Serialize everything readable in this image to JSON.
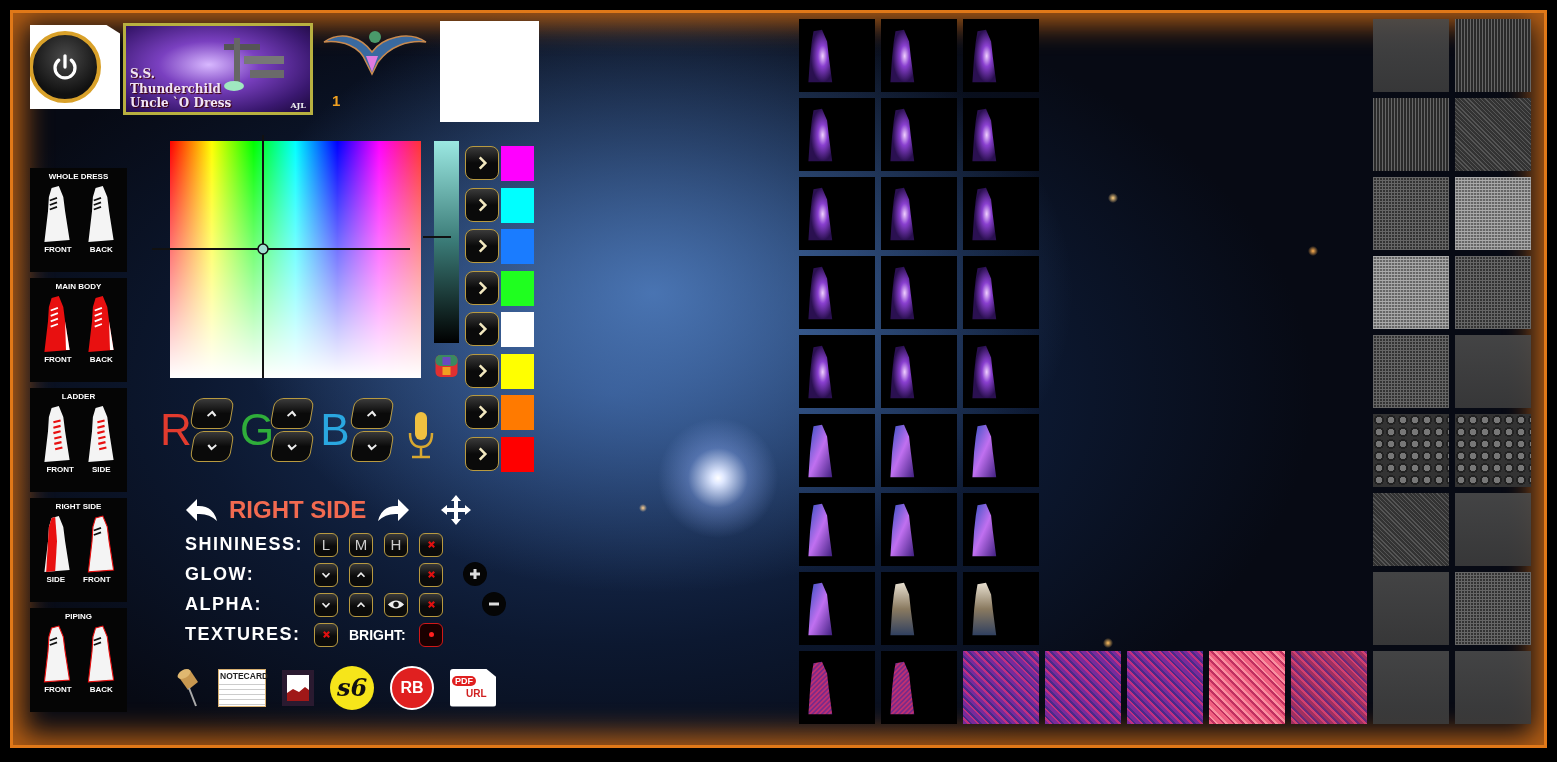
{
  "banner": {
    "lines": [
      "S.S.",
      "Thunderchild",
      "Uncle `O Dress"
    ],
    "signature": "AJL"
  },
  "counter": "1",
  "dress_parts": [
    {
      "title": "WHOLE DRESS",
      "views": [
        {
          "label": "FRONT",
          "kind": "white"
        },
        {
          "label": "BACK",
          "kind": "white"
        }
      ]
    },
    {
      "title": "MAIN BODY",
      "views": [
        {
          "label": "FRONT",
          "kind": "red"
        },
        {
          "label": "BACK",
          "kind": "red"
        }
      ]
    },
    {
      "title": "LADDER",
      "views": [
        {
          "label": "FRONT",
          "kind": "ladder"
        },
        {
          "label": "SIDE",
          "kind": "ladder"
        }
      ]
    },
    {
      "title": "RIGHT SIDE",
      "views": [
        {
          "label": "SIDE",
          "kind": "redside"
        },
        {
          "label": "FRONT",
          "kind": "piping"
        }
      ]
    },
    {
      "title": "PIPING",
      "views": [
        {
          "label": "FRONT",
          "kind": "piping"
        },
        {
          "label": "BACK",
          "kind": "piping"
        }
      ]
    }
  ],
  "brightness": {
    "level": 0.52
  },
  "color_presets": [
    {
      "color": "#ff00ff"
    },
    {
      "color": "#00ffff"
    },
    {
      "color": "#1a7cff"
    },
    {
      "color": "#1fff1f"
    },
    {
      "color": "#ffffff"
    },
    {
      "color": "#ffff00"
    },
    {
      "color": "#ff7a00"
    },
    {
      "color": "#ff0000"
    }
  ],
  "rgb": [
    {
      "letter": "R",
      "color": "#e23b2e"
    },
    {
      "letter": "G",
      "color": "#2fae3a"
    },
    {
      "letter": "B",
      "color": "#2aa7e0"
    }
  ],
  "section": {
    "title": "RIGHT SIDE",
    "rows": [
      {
        "label": "SHININESS:",
        "buttons": [
          {
            "kind": "text",
            "text": "L"
          },
          {
            "kind": "text",
            "text": "M"
          },
          {
            "kind": "text",
            "text": "H"
          },
          {
            "kind": "clear"
          }
        ]
      },
      {
        "label": "GLOW:",
        "buttons": [
          {
            "kind": "down"
          },
          {
            "kind": "up"
          },
          {
            "kind": "empty"
          },
          {
            "kind": "clear"
          }
        ]
      },
      {
        "label": "ALPHA:",
        "buttons": [
          {
            "kind": "down"
          },
          {
            "kind": "up"
          },
          {
            "kind": "eye"
          },
          {
            "kind": "clear"
          }
        ]
      },
      {
        "label": "TEXTURES:",
        "buttons": [
          {
            "kind": "clear"
          },
          {
            "kind": "label",
            "text": "BRIGHT:"
          },
          {
            "kind": "dot"
          }
        ]
      }
    ]
  },
  "tools": [
    {
      "kind": "pin"
    },
    {
      "kind": "notecard",
      "text": "NOTECARD"
    },
    {
      "kind": "image"
    },
    {
      "kind": "s6",
      "text": "s6"
    },
    {
      "kind": "rb",
      "text": "RB"
    },
    {
      "kind": "pdf",
      "text": "PDF",
      "text2": "URL"
    }
  ],
  "thumbnails": [
    {
      "kind": "nebula"
    },
    {
      "kind": "nebula"
    },
    {
      "kind": "nebula"
    },
    {
      "kind": "nebula"
    },
    {
      "kind": "nebula"
    },
    {
      "kind": "nebula"
    },
    {
      "kind": "nebula"
    },
    {
      "kind": "nebula"
    },
    {
      "kind": "nebula"
    },
    {
      "kind": "nebula"
    },
    {
      "kind": "nebula"
    },
    {
      "kind": "nebula"
    },
    {
      "kind": "nebula"
    },
    {
      "kind": "nebula"
    },
    {
      "kind": "nebula"
    },
    {
      "kind": "galaxy"
    },
    {
      "kind": "galaxy"
    },
    {
      "kind": "galaxy"
    },
    {
      "kind": "galaxy"
    },
    {
      "kind": "galaxy"
    },
    {
      "kind": "galaxy"
    },
    {
      "kind": "galaxy"
    },
    {
      "kind": "photo"
    },
    {
      "kind": "photo"
    },
    {
      "kind": "fabric"
    },
    {
      "kind": "fabric"
    },
    {
      "kind": "pattern"
    }
  ],
  "patterns": [
    {
      "kind": "pattern"
    },
    {
      "kind": "pattern"
    },
    {
      "kind": "pink"
    },
    {
      "kind": "red"
    }
  ],
  "textures": [
    {
      "kind": "gray"
    },
    {
      "kind": "stripes"
    },
    {
      "kind": "stripes"
    },
    {
      "kind": "diagonal"
    },
    {
      "kind": "mesh"
    },
    {
      "kind": "light"
    },
    {
      "kind": "light"
    },
    {
      "kind": "mesh"
    },
    {
      "kind": "mesh"
    },
    {
      "kind": "gray"
    },
    {
      "kind": "lace"
    },
    {
      "kind": "lace"
    },
    {
      "kind": "diagonal"
    },
    {
      "kind": "gray"
    },
    {
      "kind": "gray"
    },
    {
      "kind": "mesh"
    },
    {
      "kind": "gray"
    },
    {
      "kind": "gray"
    }
  ]
}
